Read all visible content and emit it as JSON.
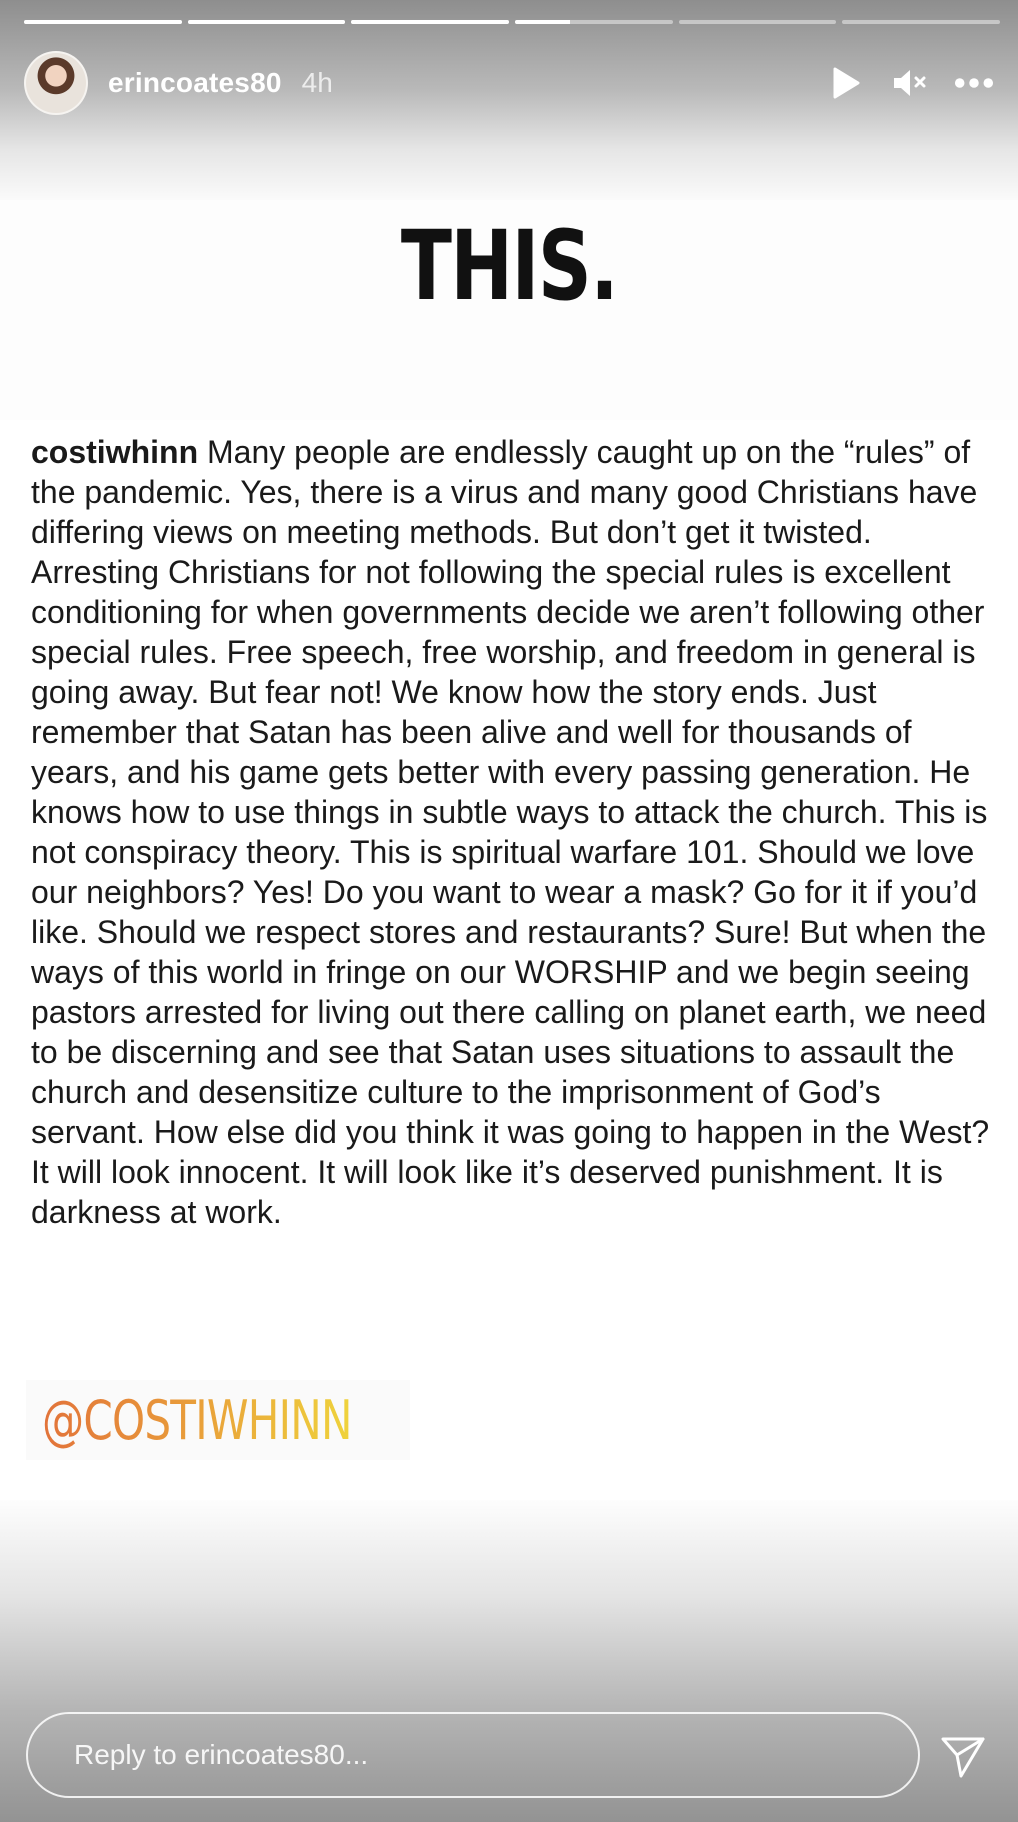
{
  "story": {
    "progress_segments": [
      {
        "fill": 1.0
      },
      {
        "fill": 1.0
      },
      {
        "fill": 1.0
      },
      {
        "fill": 0.35
      },
      {
        "fill": 0.0
      },
      {
        "fill": 0.0
      }
    ]
  },
  "header": {
    "username": "erincoates80",
    "timestamp": "4h",
    "icons": {
      "play": "play-icon",
      "mute": "volume-muted-icon",
      "more": "more-options-icon"
    }
  },
  "content": {
    "headline": "THIS.",
    "caption_handle": "costiwhinn",
    "caption_body": "Many people are endlessly caught up on the “rules” of the pandemic. Yes, there is a virus and many good Christians have differing views on meeting methods. But don’t get it twisted. Arresting Christians for not following the special rules is excellent conditioning for when governments decide we aren’t following other special rules. Free speech, free worship, and freedom in general is going away. But fear not! We know how the story ends. Just remember that Satan has been alive and well for thousands of years, and his game gets better with every passing generation. He knows how to use things in subtle ways to attack the church. This is not conspiracy theory. This is spiritual warfare 101. Should we love our neighbors? Yes! Do you want to wear a mask? Go for it if you’d like. Should we respect stores and restaurants? Sure! But when the ways of this world in fringe on our WORSHIP and we begin seeing pastors arrested for living out there calling on planet earth, we need to be discerning and see that Satan uses situations to assault the church and desensitize culture to the imprisonment of God’s servant. How else did you think it was going to happen in the West? It will look innocent. It will look like it’s deserved punishment. It is darkness at work.",
    "watermark": "@COSTIWHINN"
  },
  "footer": {
    "reply_placeholder": "Reply to erincoates80...",
    "send_icon": "send-icon"
  },
  "colors": {
    "watermark_gradient_start": "#e2733a",
    "watermark_gradient_end": "#efd33c",
    "text": "#1a1a1a"
  }
}
